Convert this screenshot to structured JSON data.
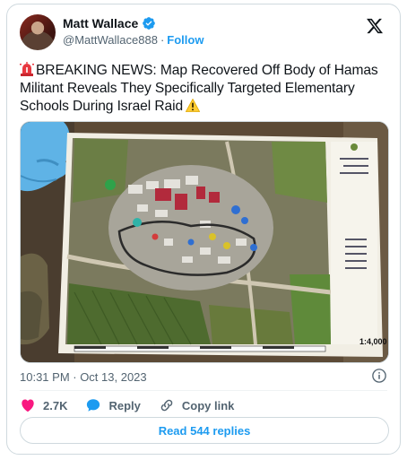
{
  "author": {
    "name": "Matt Wallace",
    "handle": "@MattWallace888",
    "separator": "·",
    "follow_label": "Follow"
  },
  "tweet": {
    "text": "BREAKING NEWS: Map Recovered Off Body of Hamas Militant Reveals They Specifically Targeted Elementary Schools During Israel Raid",
    "timestamp": "10:31 PM · Oct 13, 2023"
  },
  "media": {
    "scale_label": "1:4,000"
  },
  "actions": {
    "like_count": "2.7K",
    "reply_label": "Reply",
    "copy_label": "Copy link"
  },
  "read_replies_label": "Read 544 replies",
  "colors": {
    "accent": "#1d9bf0",
    "like": "#f91880",
    "muted": "#536471"
  },
  "icons": [
    "verified-icon",
    "x-logo-icon",
    "siren-emoji-icon",
    "warning-emoji-icon",
    "info-icon",
    "heart-icon",
    "reply-bubble-icon",
    "link-icon"
  ]
}
